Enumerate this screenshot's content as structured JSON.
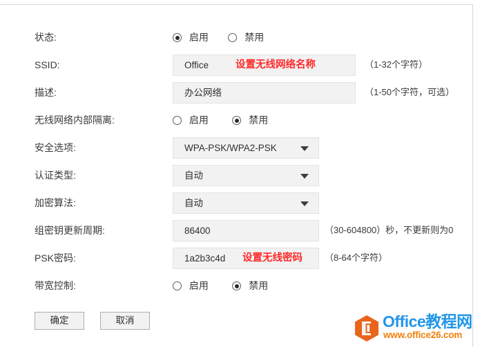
{
  "form": {
    "rows": [
      {
        "id": "status",
        "label": "状态:",
        "type": "radio",
        "options": [
          {
            "label": "启用",
            "selected": true
          },
          {
            "label": "禁用",
            "selected": false
          }
        ]
      },
      {
        "id": "ssid",
        "label": "SSID:",
        "type": "text",
        "value": "Office",
        "annotation": "设置无线网络名称",
        "hint": "（1-32个字符）"
      },
      {
        "id": "description",
        "label": "描述:",
        "type": "text",
        "value": "办公网络",
        "annotation": "",
        "hint": "（1-50个字符，可选）"
      },
      {
        "id": "ap-isolation",
        "label": "无线网络内部隔离:",
        "type": "radio",
        "options": [
          {
            "label": "启用",
            "selected": false
          },
          {
            "label": "禁用",
            "selected": true
          }
        ]
      },
      {
        "id": "security-option",
        "label": "安全选项:",
        "type": "select",
        "value": "WPA-PSK/WPA2-PSK"
      },
      {
        "id": "auth-type",
        "label": "认证类型:",
        "type": "select",
        "value": "自动"
      },
      {
        "id": "encryption-algorithm",
        "label": "加密算法:",
        "type": "select",
        "value": "自动"
      },
      {
        "id": "group-key-update",
        "label": "组密钥更新周期:",
        "type": "text",
        "value": "86400",
        "annotation": "",
        "hint": "（30-604800）秒，不更新则为0"
      },
      {
        "id": "psk-password",
        "label": "PSK密码:",
        "type": "text",
        "value": "1a2b3c4d",
        "annotation": "设置无线密码",
        "hint": "（8-64个字符）"
      },
      {
        "id": "bandwidth-control",
        "label": "带宽控制:",
        "type": "radio",
        "options": [
          {
            "label": "启用",
            "selected": false
          },
          {
            "label": "禁用",
            "selected": true
          }
        ]
      }
    ],
    "buttons": {
      "confirm": "确定",
      "cancel": "取消"
    }
  },
  "watermark": {
    "icon": "office-logo-icon",
    "title": "Office教程网",
    "url": "www.office26.com",
    "title_color": "#2196e8",
    "url_color": "#f0800c",
    "hex_color": "#e8651b"
  },
  "colors": {
    "field_bg": "#f2f2f2",
    "field_border": "#e2e2e2",
    "annotation_red": "#ff2a2a",
    "text": "#3a3a3a",
    "page_border": "#ccd6e0"
  }
}
